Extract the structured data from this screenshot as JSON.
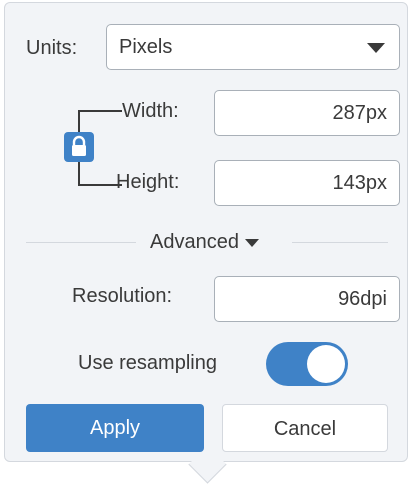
{
  "units": {
    "label": "Units:",
    "selected": "Pixels"
  },
  "size": {
    "width_label": "Width:",
    "width_value": "287px",
    "height_label": "Height:",
    "height_value": "143px",
    "aspect_lock": "locked"
  },
  "advanced": {
    "label": "Advanced"
  },
  "resolution": {
    "label": "Resolution:",
    "value": "96dpi"
  },
  "resampling": {
    "label": "Use resampling",
    "enabled": true
  },
  "buttons": {
    "apply": "Apply",
    "cancel": "Cancel"
  },
  "colors": {
    "accent": "#3f82c7",
    "panel_background": "#f2f4f7",
    "text": "#3a3a3a"
  },
  "icons": {
    "lock": "lock-icon",
    "units_dropdown": "chevron-down-icon",
    "advanced_toggle": "chevron-down-icon"
  }
}
